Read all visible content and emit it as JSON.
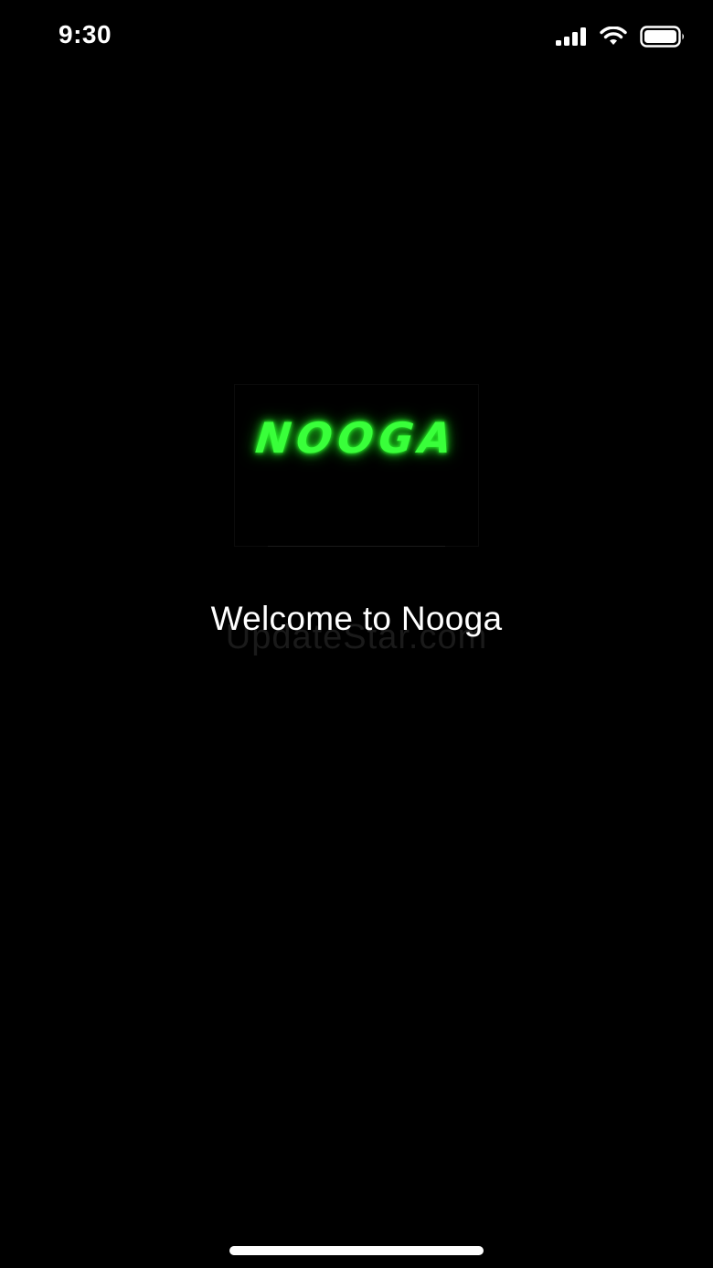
{
  "status_bar": {
    "time": "9:30",
    "signal_icon": "cellular-signal-icon",
    "wifi_icon": "wifi-icon",
    "battery_icon": "battery-icon"
  },
  "splash": {
    "logo_text": "NOOGA",
    "logo_color": "#39ff3a",
    "welcome_text": "Welcome to Nooga",
    "watermark_text": "UpdateStar.com"
  },
  "colors": {
    "background": "#000000",
    "text": "#ffffff"
  }
}
